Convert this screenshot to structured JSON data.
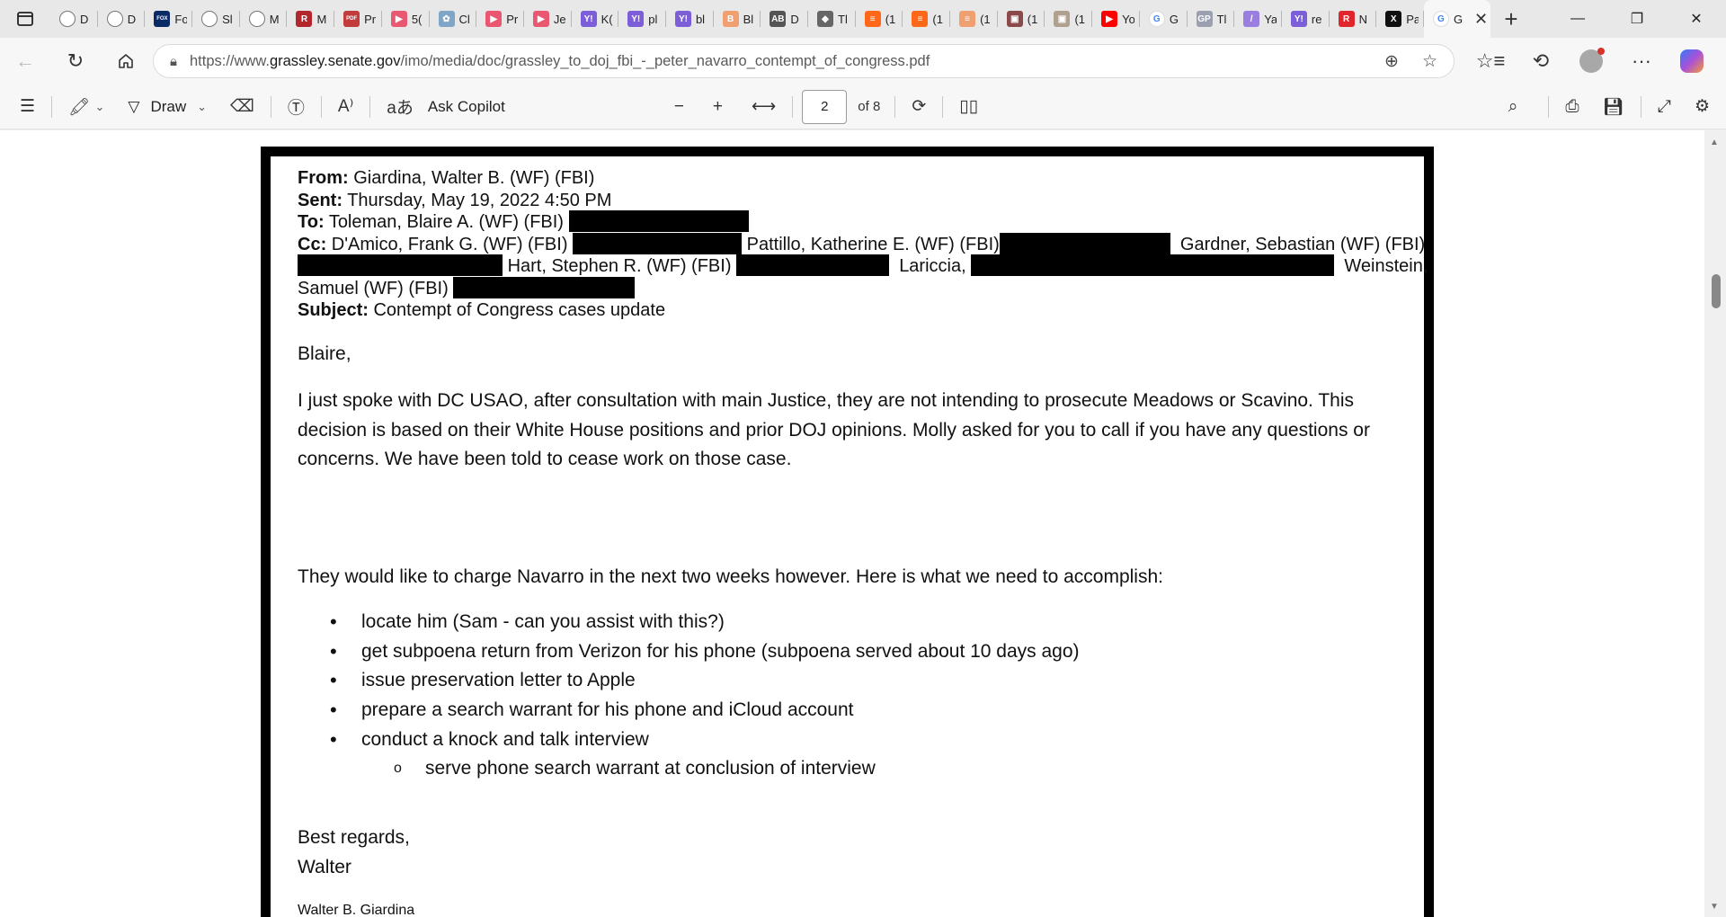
{
  "browser": {
    "tabs": [
      {
        "label": "D",
        "icon": "globe-icon",
        "color": "#ffffff"
      },
      {
        "label": "D",
        "icon": "globe-icon",
        "color": "#ffffff"
      },
      {
        "label": "Fo",
        "icon": "fox-news-icon",
        "color": "#0a2a66"
      },
      {
        "label": "Sl",
        "icon": "globe-icon",
        "color": "#ffffff"
      },
      {
        "label": "M",
        "icon": "globe-icon",
        "color": "#ffffff"
      },
      {
        "label": "M",
        "icon": "r-logo-icon",
        "color": "#b3262b"
      },
      {
        "label": "Pr",
        "icon": "pdf-icon",
        "color": "#c43b3b"
      },
      {
        "label": "5(",
        "icon": "youtube-icon",
        "color": "#e95870"
      },
      {
        "label": "Cl",
        "icon": "nature-icon",
        "color": "#7fa6c6"
      },
      {
        "label": "Pr",
        "icon": "youtube-icon",
        "color": "#e95870"
      },
      {
        "label": "Je",
        "icon": "youtube-icon",
        "color": "#e95870"
      },
      {
        "label": "K(",
        "icon": "yahoo-icon",
        "color": "#7c5fd8"
      },
      {
        "label": "pl",
        "icon": "yahoo-icon",
        "color": "#7c5fd8"
      },
      {
        "label": "bl",
        "icon": "yahoo-icon",
        "color": "#7c5fd8"
      },
      {
        "label": "Bl",
        "icon": "b-logo-icon",
        "color": "#f0a070"
      },
      {
        "label": "D",
        "icon": "ab-logo-icon",
        "color": "#555555"
      },
      {
        "label": "Tl",
        "icon": "diamond-icon",
        "color": "#666666"
      },
      {
        "label": "(1",
        "icon": "substack-icon",
        "color": "#ff6719"
      },
      {
        "label": "(1",
        "icon": "substack-icon",
        "color": "#ff6719"
      },
      {
        "label": "(1",
        "icon": "substack-icon",
        "color": "#f0a070"
      },
      {
        "label": "(1",
        "icon": "photo-icon",
        "color": "#8b4a4a"
      },
      {
        "label": "(1",
        "icon": "photo-icon",
        "color": "#b0a090"
      },
      {
        "label": "Yo",
        "icon": "youtube-icon",
        "color": "#ff0000"
      },
      {
        "label": "G",
        "icon": "google-icon",
        "color": "#4285f4"
      },
      {
        "label": "Tl",
        "icon": "gp-icon",
        "color": "#9aa0b0"
      },
      {
        "label": "Ya",
        "icon": "yahoo-slash-icon",
        "color": "#9a7fe0"
      },
      {
        "label": "re",
        "icon": "yahoo-icon",
        "color": "#7c5fd8"
      },
      {
        "label": "N",
        "icon": "r-logo-icon",
        "color": "#e0262b"
      },
      {
        "label": "Pa",
        "icon": "x-logo-icon",
        "color": "#111111"
      }
    ],
    "active_tab": {
      "label": "G",
      "icon": "google-icon"
    },
    "address": {
      "url_prefix": "https://www.",
      "url_host": "grassley.senate.gov",
      "url_path": "/imo/media/doc/grassley_to_doj_fbi_-_peter_navarro_contempt_of_congress.pdf"
    }
  },
  "pdf_toolbar": {
    "draw_label": "Draw",
    "copilot_label": "Ask Copilot",
    "page_current": "2",
    "page_total_label": "of 8"
  },
  "email": {
    "from_label": "From:",
    "from_value": "Giardina, Walter B. (WF) (FBI)",
    "sent_label": "Sent:",
    "sent_value": "Thursday, May 19, 2022 4:50 PM",
    "to_label": "To:",
    "to_value": "Toleman, Blaire A. (WF) (FBI)",
    "cc_label": "Cc:",
    "cc_1": "D'Amico, Frank G. (WF) (FBI)",
    "cc_2": "Pattillo, Katherine E. (WF) (FBI)",
    "cc_3": "Gardner, Sebastian (WF) (FBI)",
    "cc_4": "Hart, Stephen R. (WF) (FBI)",
    "cc_5": "Lariccia,",
    "cc_6": "Weinstein,",
    "cc_7": "Samuel (WF) (FBI)",
    "subject_label": "Subject:",
    "subject_value": "Contempt of Congress cases update",
    "greeting": "Blaire,",
    "para1": "I just spoke with DC USAO, after consultation with main Justice, they are not intending to prosecute Meadows or Scavino.  This decision is based on their White House positions and prior DOJ opinions.  Molly asked for you to call if you have any questions or concerns.  We have been told to cease work on those case.",
    "para2": "They would like to charge Navarro in the next two weeks however.  Here is what we need to accomplish:",
    "tasks": [
      "locate him (Sam - can you assist with this?)",
      "get subpoena return from Verizon for his phone (subpoena served about 10 days ago)",
      "issue preservation letter to Apple",
      "prepare a search warrant for his phone and iCloud account",
      "conduct a knock and talk interview"
    ],
    "subtask": "serve phone search warrant at conclusion of interview",
    "closing": "Best regards,",
    "signoff": "Walter",
    "signature_name": "Walter B. Giardina"
  }
}
